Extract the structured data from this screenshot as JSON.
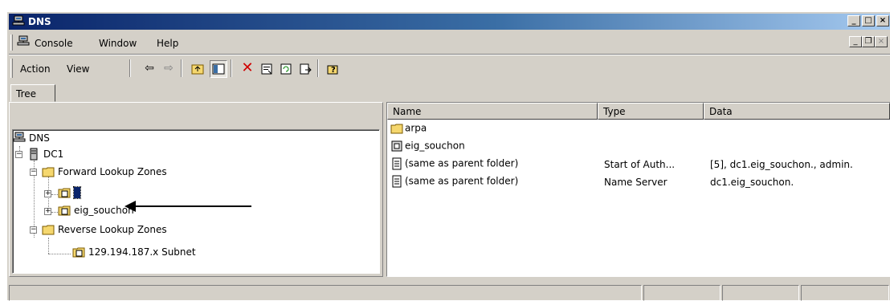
{
  "window": {
    "title": "DNS"
  },
  "menu": {
    "console": "Console",
    "window": "Window",
    "help": "Help"
  },
  "toolbar": {
    "action": "Action",
    "view": "View"
  },
  "tree": {
    "tab_label": "Tree",
    "nodes": {
      "dns": "DNS",
      "dc1": "DC1",
      "forward": "Forward Lookup Zones",
      "hidden_zone": "",
      "eig_souchon": "eig_souchon",
      "reverse": "Reverse Lookup Zones",
      "subnet": "129.194.187.x Subnet"
    }
  },
  "list": {
    "columns": {
      "name": "Name",
      "type": "Type",
      "data": "Data"
    },
    "rows": [
      {
        "name": "arpa",
        "type": "",
        "data": "",
        "icon": "folder-icon"
      },
      {
        "name": "eig_souchon",
        "type": "",
        "data": "",
        "icon": "zone-icon"
      },
      {
        "name": "(same as parent folder)",
        "type": "Start of Auth...",
        "data": "[5], dc1.eig_souchon., admin.",
        "icon": "record-icon"
      },
      {
        "name": "(same as parent folder)",
        "type": "Name Server",
        "data": "dc1.eig_souchon.",
        "icon": "record-icon"
      }
    ]
  },
  "colors": {
    "title_start": "#0a246a",
    "title_end": "#a6caf0",
    "chrome": "#d4d0c8",
    "folder": "#f5d76e"
  }
}
